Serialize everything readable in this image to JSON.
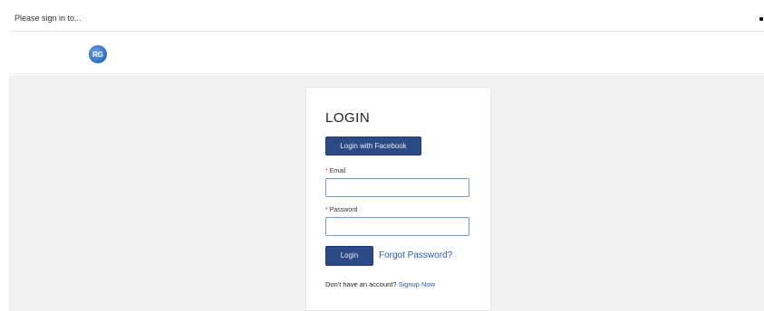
{
  "notice": {
    "text": "Please sign in to..."
  },
  "header": {
    "logo_text": "RG"
  },
  "login": {
    "title": "LOGIN",
    "facebook_button": "Login with Facebook",
    "required_mark": "*",
    "email_label": "Email",
    "email_value": "",
    "password_label": "Password",
    "password_value": "",
    "login_button": "Login",
    "forgot_password": "Forgot Password?",
    "no_account_text": "Don't have an account?",
    "signup_link": "Signup Now"
  },
  "colors": {
    "primary_button": "#2c4a86",
    "link": "#2a5aa8",
    "background": "#f1f1f1",
    "required": "#d23a2a"
  },
  "icons": {
    "logo": "globe-logo-icon"
  }
}
